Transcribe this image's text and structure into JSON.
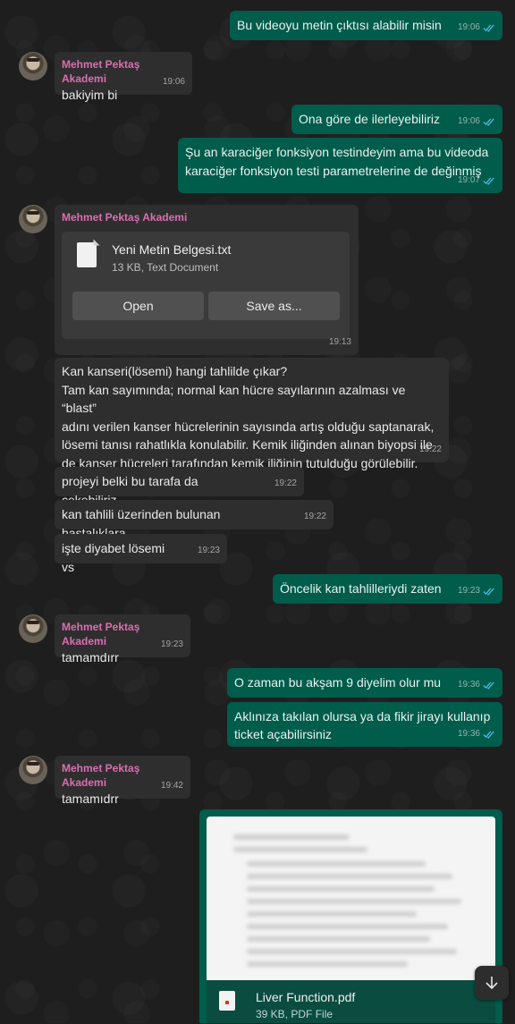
{
  "messages": {
    "m1": {
      "text": "Bu videoyu metin çıktısı alabilir misin",
      "time": "19:06"
    },
    "m2": {
      "sender": "Mehmet Pektaş Akademi",
      "text": "bakiyim bi",
      "time": "19:06"
    },
    "m3": {
      "text": "Ona göre de ilerleyebiliriz",
      "time": "19:06"
    },
    "m4": {
      "text": "Şu an karaciğer fonksiyon testindeyim ama bu videoda\nkaraciğer fonksiyon testi parametrelerine de değinmiş",
      "time": "19:07"
    },
    "m5": {
      "sender": "Mehmet Pektaş Akademi",
      "file_name": "Yeni Metin Belgesi.txt",
      "file_info": "13 KB, Text Document",
      "open_label": "Open",
      "save_label": "Save as...",
      "time": "19:13"
    },
    "m6": {
      "text": "Kan kanseri(lösemi) hangi tahlilde çıkar?\nTam kan sayımında; normal kan hücre sayılarının azalması ve “blast”\nadını verilen kanser hücrelerinin sayısında artış olduğu saptanarak,\nlösemi tanısı rahatlıkla konulabilir. Kemik iliğinden alınan biyopsi ile\nde kanser hücreleri tarafından kemik iliğinin tutulduğu görülebilir.",
      "time": "19:22"
    },
    "m7": {
      "text": "projeyi belki bu tarafa da çekebiliriz",
      "time": "19:22"
    },
    "m8": {
      "text": "kan tahlili üzerinden bulunan hastalıklara",
      "time": "19:22"
    },
    "m9": {
      "text": "işte diyabet lösemi vs",
      "time": "19:23"
    },
    "m10": {
      "text": "Öncelik kan tahlilleriydi zaten",
      "time": "19:23"
    },
    "m11": {
      "sender": "Mehmet Pektaş Akademi",
      "text": "tamamdırr",
      "time": "19:23"
    },
    "m12": {
      "text": "O zaman bu akşam 9 diyelim olur mu",
      "time": "19:36"
    },
    "m13": {
      "text": "Aklınıza takılan olursa ya da fikir jirayı kullanıp\nticket açabilirsiniz",
      "time": "19:36"
    },
    "m14": {
      "sender": "Mehmet Pektaş Akademi",
      "text": "tamamıdrr",
      "time": "19:42"
    },
    "m15": {
      "file_name": "Liver Function.pdf",
      "file_info": "39 KB, PDF File"
    }
  },
  "icons": {
    "read_ticks": "double-check-icon",
    "scroll_down": "arrow-down-icon",
    "file": "document-icon"
  },
  "colors": {
    "outgoing": "#005c4b",
    "incoming": "#2e2e2e",
    "sender_name": "#d96fb0",
    "read_tick": "#53bdeb"
  }
}
